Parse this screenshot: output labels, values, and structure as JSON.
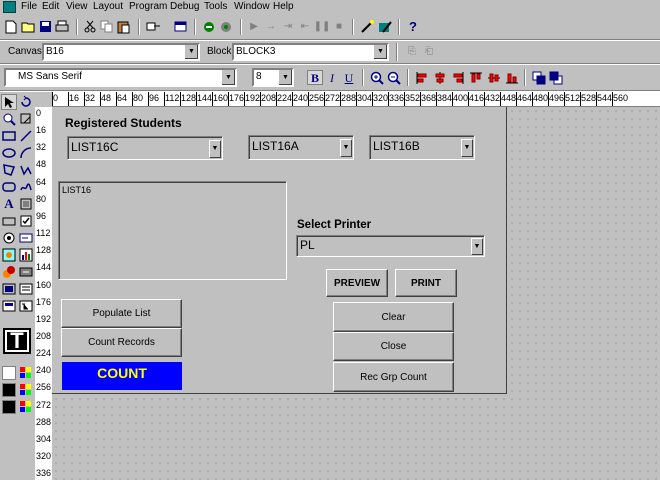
{
  "menu": {
    "items": [
      "File",
      "Edit",
      "View",
      "Layout",
      "Program",
      "Debug",
      "Tools",
      "Window",
      "Help"
    ]
  },
  "toolbar2": {
    "canvas_label": "Canvas:",
    "canvas_value": "B16",
    "block_label": "Block:",
    "block_value": "BLOCK3"
  },
  "toolbar3": {
    "font_name": "MS Sans Serif",
    "font_size": "8",
    "bold": "B",
    "italic": "I",
    "underline": "U"
  },
  "hruler": [
    "0",
    "16",
    "32",
    "48",
    "64",
    "80",
    "96",
    "112",
    "128",
    "144",
    "160",
    "176",
    "192",
    "208",
    "224",
    "240",
    "256",
    "272",
    "288",
    "304",
    "320",
    "336",
    "352",
    "368",
    "384",
    "400",
    "416",
    "432",
    "448",
    "464",
    "480",
    "496",
    "512",
    "528",
    "544",
    "560"
  ],
  "vruler": [
    "0",
    "16",
    "32",
    "48",
    "64",
    "80",
    "96",
    "112",
    "128",
    "144",
    "160",
    "176",
    "192",
    "208",
    "224",
    "240",
    "256",
    "272",
    "288",
    "304",
    "320",
    "336"
  ],
  "form": {
    "title": "Registered Students",
    "list1": "LIST16C",
    "list2": "LIST16A",
    "list3": "LIST16B",
    "listbox_label": "LIST16",
    "printer_label": "Select Printer",
    "printer_value": "PL",
    "preview": "PREVIEW",
    "print": "PRINT",
    "populate": "Populate List",
    "count_records": "Count Records",
    "count": "COUNT",
    "clear": "Clear",
    "close": "Close",
    "rec_grp_count": "Rec Grp Count"
  },
  "colors": {
    "count_bg": "#0000ff",
    "count_fg": "#ffff00",
    "face": "#c0c0c0"
  }
}
